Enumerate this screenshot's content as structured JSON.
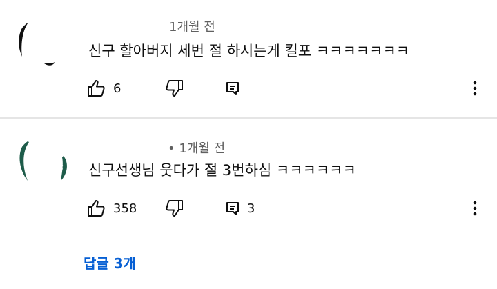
{
  "comments": [
    {
      "meta": "1개월 전",
      "text": "신구 할아버지 세번 절 하시는게 킬포 ㅋㅋㅋㅋㅋㅋㅋ",
      "like_count": "6",
      "reply_count": "",
      "avatar_color": "#111111"
    },
    {
      "meta": "• 1개월 전",
      "text": "신구선생님 웃다가 절 3번하심 ㅋㅋㅋㅋㅋㅋ",
      "like_count": "358",
      "reply_count": "3",
      "avatar_color": "#1e5c4a"
    }
  ],
  "replies_link": "답글 3개",
  "colors": {
    "link": "#065fd4",
    "meta": "#606060",
    "text": "#0f0f0f",
    "divider": "#e5e5e5"
  },
  "icons": [
    "thumbs-up-icon",
    "thumbs-down-icon",
    "reply-comment-icon",
    "more-vert-icon"
  ]
}
